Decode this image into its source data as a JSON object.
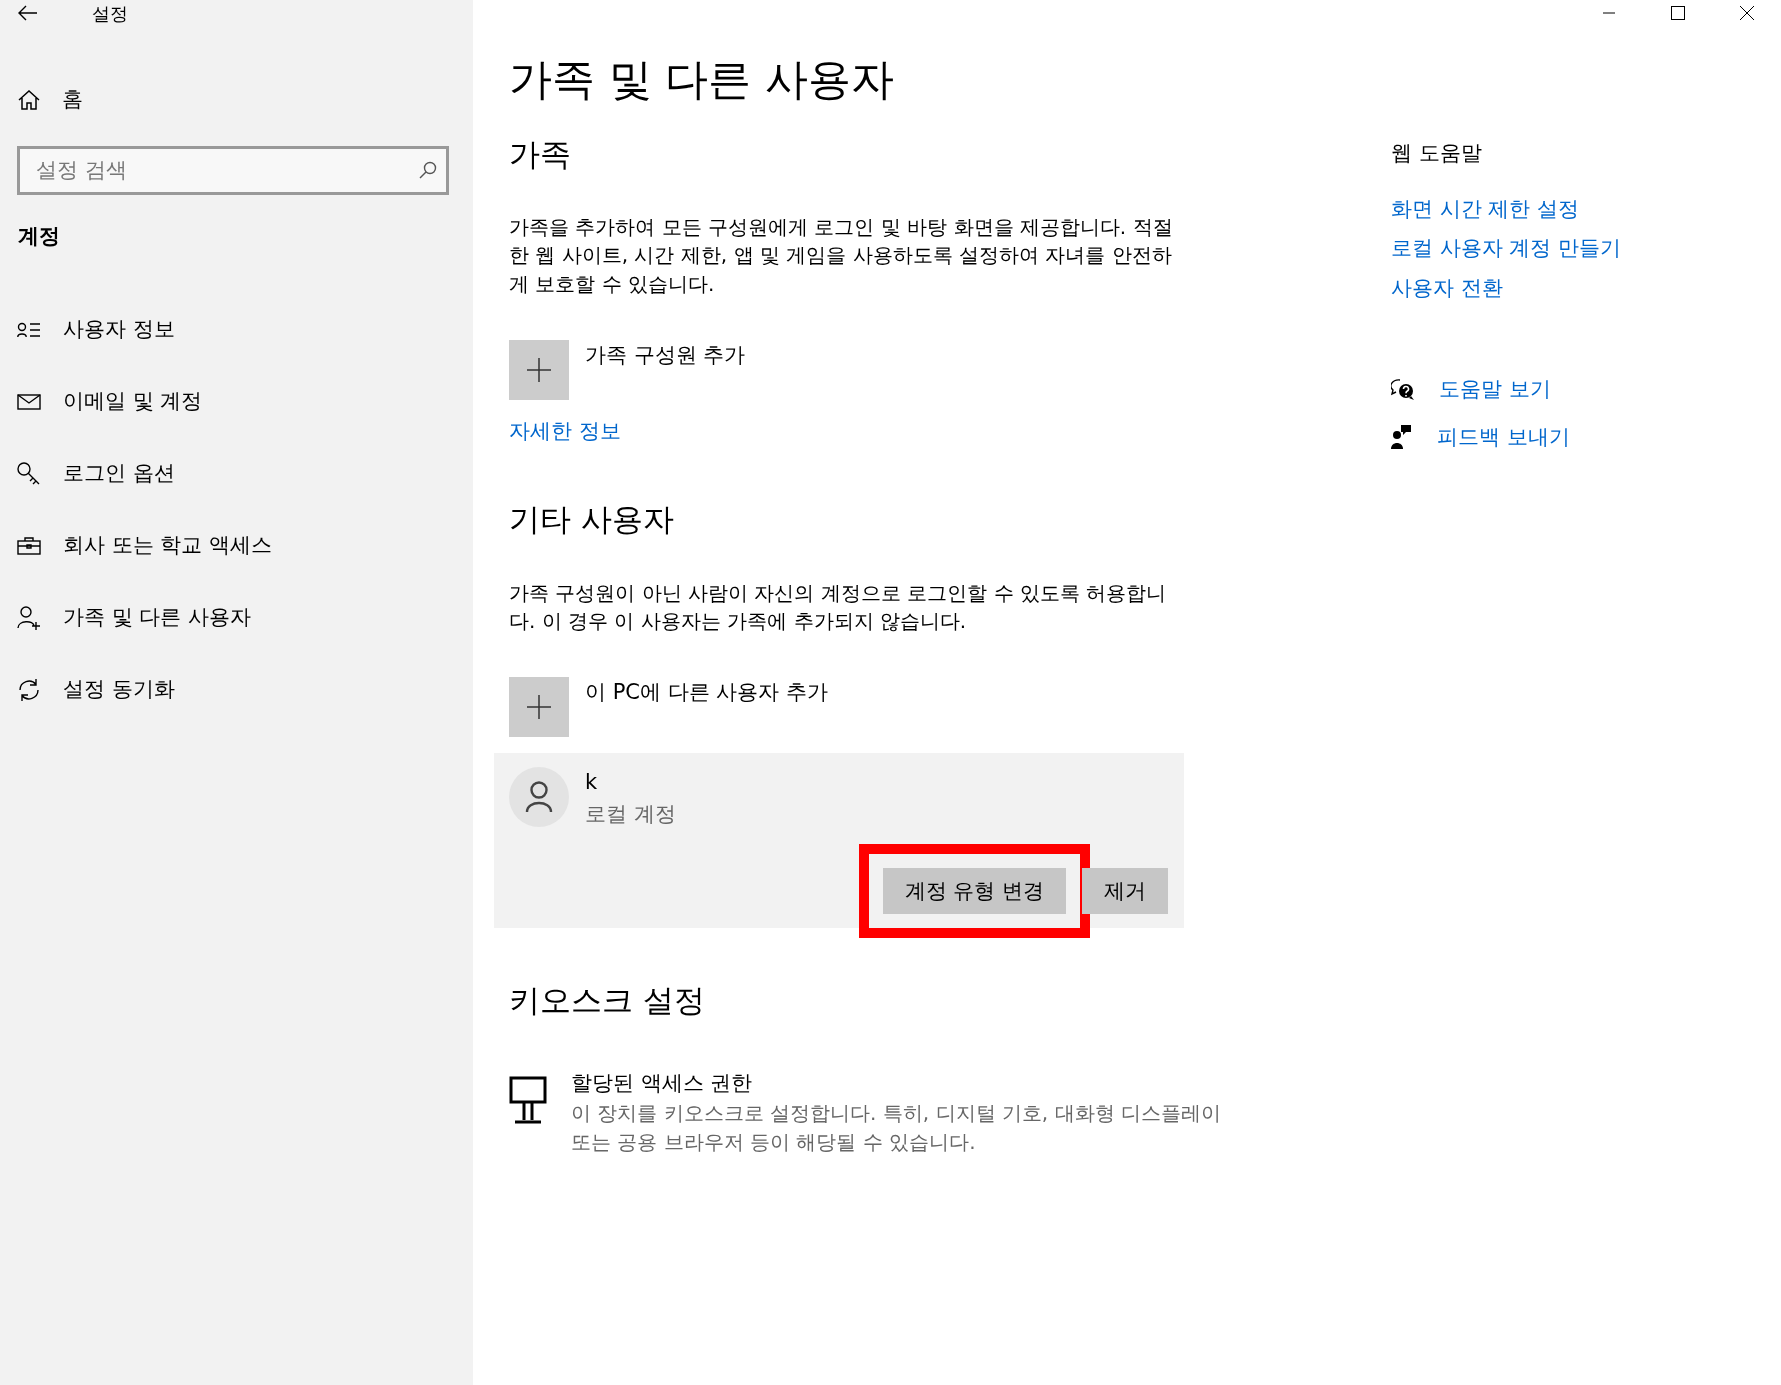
{
  "window": {
    "title": "설정"
  },
  "sidebar": {
    "home": "홈",
    "search": {
      "placeholder": "설정 검색"
    },
    "section": "계정",
    "items": [
      {
        "kind": "user-info",
        "label": "사용자 정보"
      },
      {
        "kind": "mail",
        "label": "이메일 및 계정"
      },
      {
        "kind": "key",
        "label": "로그인 옵션"
      },
      {
        "kind": "briefcase",
        "label": "회사 또는 학교 액세스"
      },
      {
        "kind": "user-add",
        "label": "가족 및 다른 사용자"
      },
      {
        "kind": "sync",
        "label": "설정 동기화"
      }
    ]
  },
  "main": {
    "title": "가족 및 다른 사용자",
    "family": {
      "heading": "가족",
      "description": "가족을 추가하여 모든 구성원에게 로그인 및 바탕 화면을 제공합니다. 적절한 웹 사이트, 시간 제한, 앱 및 게임을 사용하도록 설정하여 자녀를 안전하게 보호할 수 있습니다.",
      "add_label": "가족 구성원 추가",
      "link": "자세한 정보"
    },
    "other_users": {
      "heading": "기타 사용자",
      "description": "가족 구성원이 아닌 사람이 자신의 계정으로 로그인할 수 있도록 허용합니다. 이 경우 이 사용자는 가족에 추가되지 않습니다.",
      "add_label": "이 PC에 다른 사용자 추가",
      "users": [
        {
          "name": "k",
          "type": "로컬 계정",
          "buttons": [
            {
              "label": "계정 유형 변경",
              "highlighted": true
            },
            {
              "label": "제거",
              "highlighted": false
            }
          ]
        }
      ]
    },
    "kiosk": {
      "heading": "키오스크 설정",
      "item_title": "할당된 액세스 권한",
      "item_description": "이 장치를 키오스크로 설정합니다. 특히, 디지털 기호, 대화형 디스플레이 또는 공용 브라우저 등이 해당될 수 있습니다."
    }
  },
  "help": {
    "heading": "웹 도움말",
    "links": [
      "화면 시간 제한 설정",
      "로컬 사용자 계정 만들기",
      "사용자 전환"
    ],
    "support": [
      {
        "kind": "help",
        "label": "도움말 보기"
      },
      {
        "kind": "feedback",
        "label": "피드백 보내기"
      }
    ]
  }
}
